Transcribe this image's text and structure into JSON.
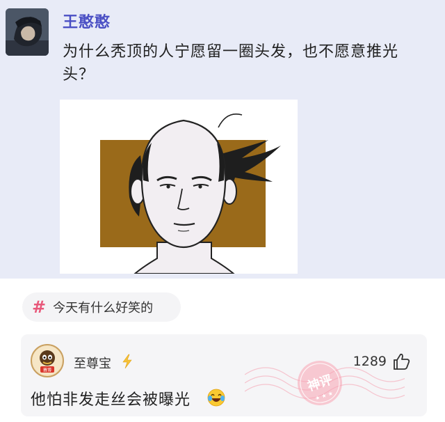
{
  "post": {
    "author": "王憨憨",
    "question": "为什么秃顶的人宁愿留一圈头发，也不愿意推光头？"
  },
  "topic": {
    "symbol": "#",
    "label": "今天有什么好笑的"
  },
  "comment": {
    "username": "至尊宝",
    "likes": "1289",
    "text": "他怕非发走丝会被曝光",
    "stamp_text": "神评",
    "avatar_text": "赛博"
  },
  "colors": {
    "post_bg": "#e8ebf7",
    "author": "#4a4fc4",
    "hash": "#e8587a",
    "stamp": "#f07a90",
    "square": "#9a6a1a"
  }
}
